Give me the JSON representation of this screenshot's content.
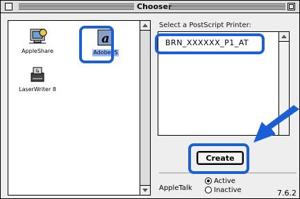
{
  "window": {
    "title": "Chooser"
  },
  "devices": [
    {
      "label": "AppleShare",
      "icon": "appleshare-icon"
    },
    {
      "label": "AdobePS",
      "icon": "adobeps-icon",
      "selected": true
    },
    {
      "label": "LaserWriter 8",
      "icon": "laserwriter-icon"
    }
  ],
  "printers": {
    "prompt": "Select a PostScript Printer:",
    "items": [
      "BRN_XXXXXX_P1_AT"
    ]
  },
  "buttons": {
    "create": "Create"
  },
  "appletalk": {
    "label": "AppleTalk",
    "options": [
      {
        "label": "Active",
        "selected": true
      },
      {
        "label": "Inactive",
        "selected": false
      }
    ]
  },
  "version": "7.6.2",
  "colors": {
    "highlight": "#1a5fd6",
    "selection": "#93b6ff"
  }
}
